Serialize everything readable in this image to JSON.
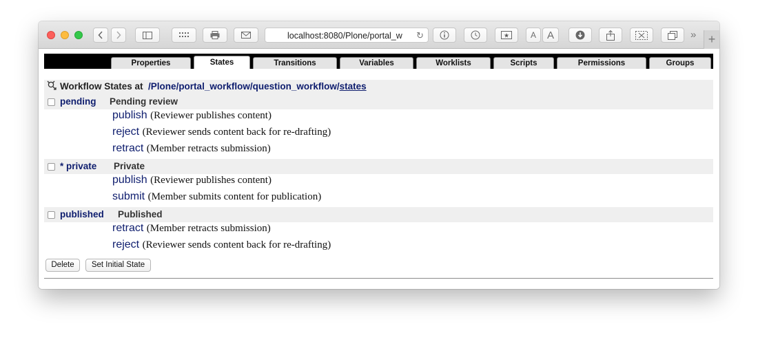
{
  "browser": {
    "url": "localhost:8080/Plone/portal_w",
    "icons": [
      "back-icon",
      "forward-icon",
      "sidebar-icon",
      "grid-icon",
      "print-icon",
      "mail-icon",
      "info-icon",
      "history-icon",
      "bookmark-star-icon",
      "font-smaller-icon",
      "font-larger-icon",
      "download-icon",
      "share-icon",
      "clip-icon",
      "tabs-icon",
      "more-icon",
      "new-tab-icon"
    ],
    "font_small_label": "A",
    "font_large_label": "A",
    "more_label": "»",
    "new_tab_label": "+"
  },
  "tabs": [
    {
      "label": "Properties"
    },
    {
      "label": "States"
    },
    {
      "label": "Transitions"
    },
    {
      "label": "Variables"
    },
    {
      "label": "Worklists"
    },
    {
      "label": "Scripts"
    },
    {
      "label": "Permissions"
    },
    {
      "label": "Groups"
    }
  ],
  "active_tab": "States",
  "heading": {
    "prefix": "Workflow States at",
    "path_parts": [
      "/Plone",
      "/portal_workflow",
      "/question_workflow",
      "/"
    ],
    "path_last": "states"
  },
  "states": [
    {
      "id": "pending",
      "title": "Pending review",
      "transitions": [
        {
          "name": "publish",
          "description": "(Reviewer publishes content)"
        },
        {
          "name": "reject",
          "description": "(Reviewer sends content back for re-drafting)"
        },
        {
          "name": "retract",
          "description": "(Member retracts submission)"
        }
      ]
    },
    {
      "id": "* private",
      "title": "Private",
      "transitions": [
        {
          "name": "publish",
          "description": "(Reviewer publishes content)"
        },
        {
          "name": "submit",
          "description": "(Member submits content for publication)"
        }
      ]
    },
    {
      "id": "published",
      "title": "Published",
      "transitions": [
        {
          "name": "retract",
          "description": "(Member retracts submission)"
        },
        {
          "name": "reject",
          "description": "(Reviewer sends content back for re-drafting)"
        }
      ]
    }
  ],
  "buttons": {
    "delete": "Delete",
    "set_initial": "Set Initial State"
  },
  "colors": {
    "link": "#0e1d6e",
    "row_background": "#efefef",
    "tab_bar": "#000000"
  }
}
